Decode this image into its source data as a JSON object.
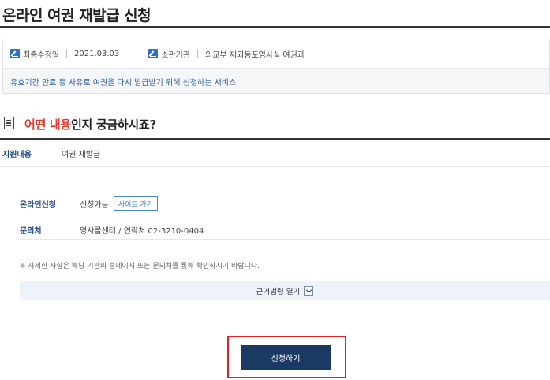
{
  "page": {
    "title": "온라인 여권 재발급 신청"
  },
  "meta": {
    "updated_label": "최종수정일",
    "updated_value": "2021.03.03",
    "agency_label": "소관기관",
    "agency_value": "외교부 재외동포영사실 여권과",
    "icon": "edit-icon",
    "description": "유효기간 만료 등 사유로 여권을 다시 발급받기 위해 신청하는 서비스"
  },
  "section": {
    "icon": "document-icon",
    "title_highlight": "어떤 내용",
    "title_rest": "인지 궁금하시죠?",
    "highlight_color": "#e23b2e"
  },
  "support": {
    "label": "지원내용",
    "value": "여권 재발급"
  },
  "online": {
    "label": "온라인신청",
    "status": "신청가능",
    "site_button": "사이트 가기"
  },
  "contact": {
    "label": "문의처",
    "value": "영사콜센터 / 연락처 02-3210-0404"
  },
  "notice": "※ 자세한 사항은 해당 기관의 홈페이지 또는 문의처를 통해 확인하시기 바랍니다.",
  "law": {
    "label": "근거법령 열기"
  },
  "apply": {
    "label": "신청하기",
    "color": "#1b3a63",
    "highlight_color": "#e02020"
  }
}
